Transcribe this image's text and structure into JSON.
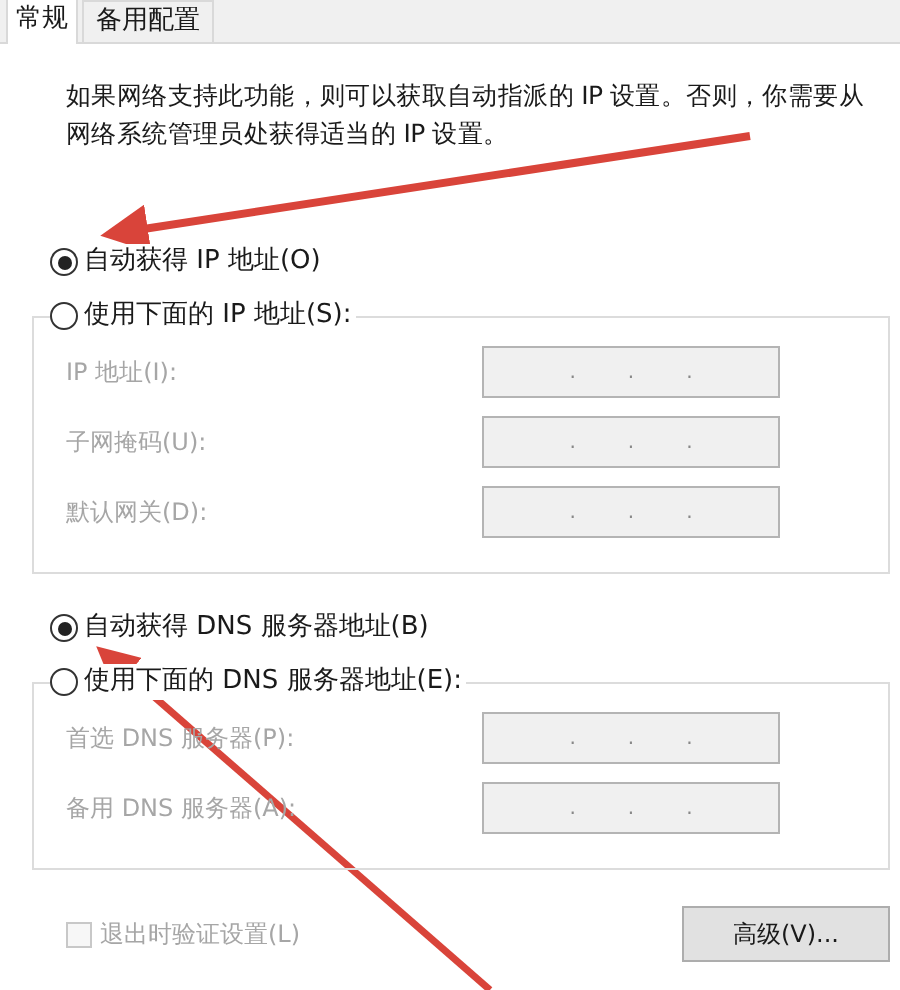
{
  "tabs": [
    {
      "label": "常规",
      "selected": true
    },
    {
      "label": "备用配置",
      "selected": false
    }
  ],
  "description": "如果网络支持此功能，则可以获取自动指派的 IP 设置。否则，你需要从网络系统管理员处获得适当的 IP 设置。",
  "ip_options": [
    {
      "label": "自动获得 IP 地址(O)",
      "selected": true
    },
    {
      "label": "使用下面的 IP 地址(S):",
      "selected": false
    }
  ],
  "ip_fields": [
    {
      "label": "IP 地址(I):",
      "disabled": true,
      "separators": [
        ".",
        ".",
        "."
      ]
    },
    {
      "label": "子网掩码(U):",
      "disabled": true,
      "separators": [
        ".",
        ".",
        "."
      ]
    },
    {
      "label": "默认网关(D):",
      "disabled": true,
      "separators": [
        ".",
        ".",
        "."
      ]
    }
  ],
  "dns_options": [
    {
      "label": "自动获得 DNS 服务器地址(B)",
      "selected": true
    },
    {
      "label": "使用下面的 DNS 服务器地址(E):",
      "selected": false
    }
  ],
  "dns_fields": [
    {
      "label": "首选 DNS 服务器(P):",
      "disabled": true,
      "separators": [
        ".",
        ".",
        "."
      ]
    },
    {
      "label": "备用 DNS 服务器(A):",
      "disabled": true,
      "separators": [
        ".",
        ".",
        "."
      ]
    }
  ],
  "validate_checkbox": {
    "label": "退出时验证设置(L)",
    "checked": false,
    "disabled": true
  },
  "advanced_button": {
    "label": "高级(V)..."
  }
}
